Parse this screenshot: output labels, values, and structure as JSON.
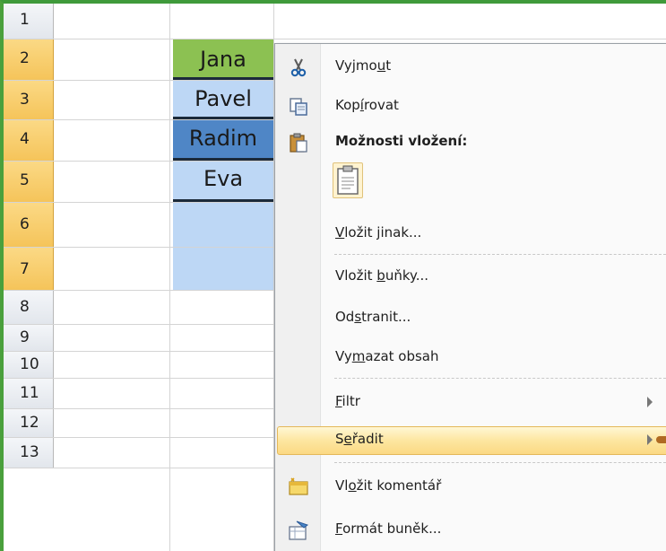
{
  "rows": [
    {
      "num": "1"
    },
    {
      "num": "2"
    },
    {
      "num": "3"
    },
    {
      "num": "4"
    },
    {
      "num": "5"
    },
    {
      "num": "6"
    },
    {
      "num": "7"
    },
    {
      "num": "8"
    },
    {
      "num": "9"
    },
    {
      "num": "10"
    },
    {
      "num": "11"
    },
    {
      "num": "12"
    },
    {
      "num": "13"
    }
  ],
  "cells": {
    "b2": "Jana",
    "b3": "Pavel",
    "b4": "Radim",
    "b5": "Eva"
  },
  "menu": {
    "cut": {
      "pre": "Vyjmo",
      "u": "u",
      "post": "t"
    },
    "copy": {
      "pre": "Kop",
      "u": "í",
      "post": "rovat"
    },
    "paste_options": "Možnosti vložení:",
    "paste_special": {
      "pre": "",
      "u": "V",
      "post": "ložit jinak..."
    },
    "insert_cells": {
      "pre": "Vložit ",
      "u": "b",
      "post": "uňky..."
    },
    "delete": {
      "pre": "Od",
      "u": "s",
      "post": "tranit..."
    },
    "clear": {
      "pre": "Vy",
      "u": "m",
      "post": "azat obsah"
    },
    "filter": {
      "pre": "",
      "u": "F",
      "post": "iltr"
    },
    "sort": {
      "pre": "S",
      "u": "e",
      "post": "řadit"
    },
    "comment": {
      "pre": "Vl",
      "u": "o",
      "post": "žit komentář"
    },
    "format": {
      "pre": "",
      "u": "F",
      "post": "ormát buněk..."
    }
  },
  "colors": {
    "selected_row_header": "#f5c45a",
    "green_cell": "#8cc152",
    "light_blue_cell": "#bdd7f5",
    "dark_blue_cell": "#4f86c6",
    "menu_highlight": "#fde6a0"
  },
  "icons": {
    "cut": "scissors-icon",
    "copy": "copy-icon",
    "paste": "clipboard-icon",
    "comment": "comment-icon",
    "format": "format-cells-icon"
  }
}
